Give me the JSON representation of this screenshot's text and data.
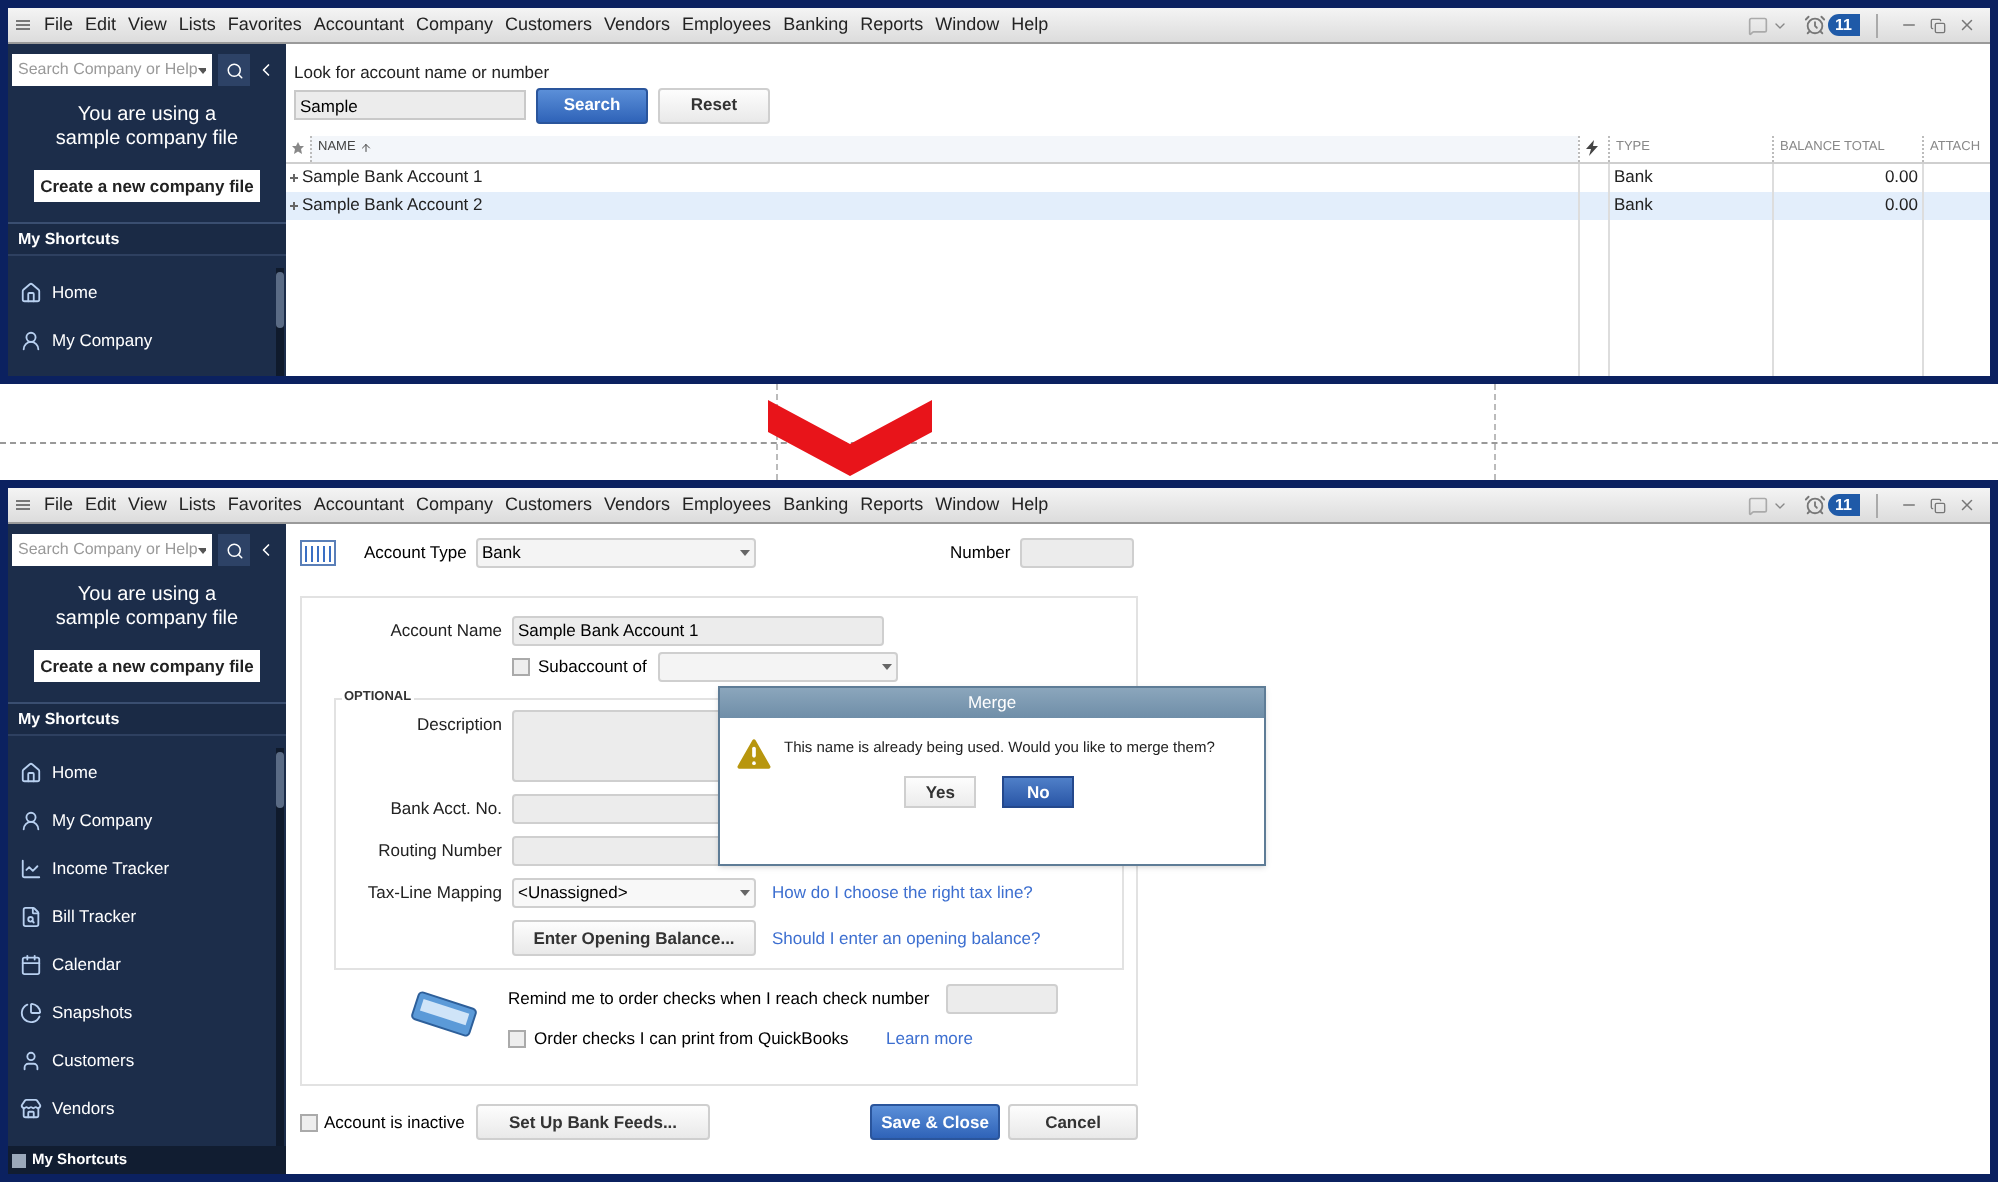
{
  "top_window": {
    "menu": [
      "File",
      "Edit",
      "View",
      "Lists",
      "Favorites",
      "Accountant",
      "Company",
      "Customers",
      "Vendors",
      "Employees",
      "Banking",
      "Reports",
      "Window",
      "Help"
    ],
    "alert_count": "11",
    "sidebar": {
      "search_placeholder": "Search Company or Help",
      "notice": "You are using a sample company file",
      "create_button": "Create a new company file",
      "shortcuts_header": "My Shortcuts",
      "items": [
        {
          "label": "Home"
        },
        {
          "label": "My Company"
        }
      ]
    },
    "search": {
      "label": "Look for account name or number",
      "value": "Sample",
      "buttons": [
        {
          "label": "Search",
          "primary": true
        },
        {
          "label": "Reset",
          "primary": false
        }
      ]
    },
    "table": {
      "columns": [
        {
          "kind": "name",
          "label": "NAME",
          "sorted": true
        },
        {
          "kind": "flag",
          "sorted": false
        },
        {
          "kind": "type",
          "label": "TYPE",
          "sorted": false
        },
        {
          "kind": "balance",
          "label": "BALANCE TOTAL",
          "sorted": false
        },
        {
          "kind": "attach",
          "label": "ATTACH",
          "sorted": false
        }
      ],
      "rows": [
        {
          "name": "Sample Bank Account 1",
          "type": "Bank",
          "balance_total": "0.00",
          "selected": false
        },
        {
          "name": "Sample Bank Account 2",
          "type": "Bank",
          "balance_total": "0.00",
          "selected": true
        }
      ]
    }
  },
  "bottom_window": {
    "menu": [
      "File",
      "Edit",
      "View",
      "Lists",
      "Favorites",
      "Accountant",
      "Company",
      "Customers",
      "Vendors",
      "Employees",
      "Banking",
      "Reports",
      "Window",
      "Help"
    ],
    "alert_count": "11",
    "sidebar": {
      "search_placeholder": "Search Company or Help",
      "notice": "You are using a sample company file",
      "create_button": "Create a new company file",
      "shortcuts_header": "My Shortcuts",
      "items": [
        {
          "label": "Home"
        },
        {
          "label": "My Company"
        },
        {
          "label": "Income Tracker"
        },
        {
          "label": "Bill Tracker"
        },
        {
          "label": "Calendar"
        },
        {
          "label": "Snapshots"
        },
        {
          "label": "Customers"
        },
        {
          "label": "Vendors"
        }
      ],
      "footer": "My Shortcuts"
    },
    "account_type": {
      "label": "Account Type",
      "value": "Bank"
    },
    "number": {
      "label": "Number"
    },
    "account_name": {
      "label": "Account Name",
      "value": "Sample Bank Account 1"
    },
    "subaccount": {
      "label": "Subaccount of",
      "checked": false
    },
    "optional": {
      "label": "OPTIONAL",
      "fields": [
        {
          "kind": "textarea",
          "label": "Description"
        },
        {
          "kind": "text",
          "label": "Bank Acct. No."
        },
        {
          "kind": "text",
          "label": "Routing Number"
        },
        {
          "kind": "select",
          "label": "Tax-Line Mapping",
          "value": "<Unassigned>",
          "link": "How do I choose the right tax line?"
        },
        {
          "kind": "button",
          "label": "Enter Opening Balance...",
          "link": "Should I enter an opening balance?"
        }
      ]
    },
    "checks": {
      "reminder": "Remind me to order checks when I reach check number",
      "order_label": "Order checks I can print from QuickBooks",
      "order_checked": false,
      "link": "Learn more"
    },
    "inactive": {
      "label": "Account is inactive",
      "checked": false
    },
    "bank_feeds_button": "Set Up Bank Feeds...",
    "actions": [
      {
        "label": "Save & Close",
        "primary": true
      },
      {
        "label": "Cancel",
        "primary": false
      }
    ],
    "dialog": {
      "title": "Merge",
      "message": "This name is already being used. Would you like to merge them?",
      "buttons": [
        {
          "label": "Yes",
          "default": false
        },
        {
          "label": "No",
          "default": true
        }
      ]
    }
  }
}
